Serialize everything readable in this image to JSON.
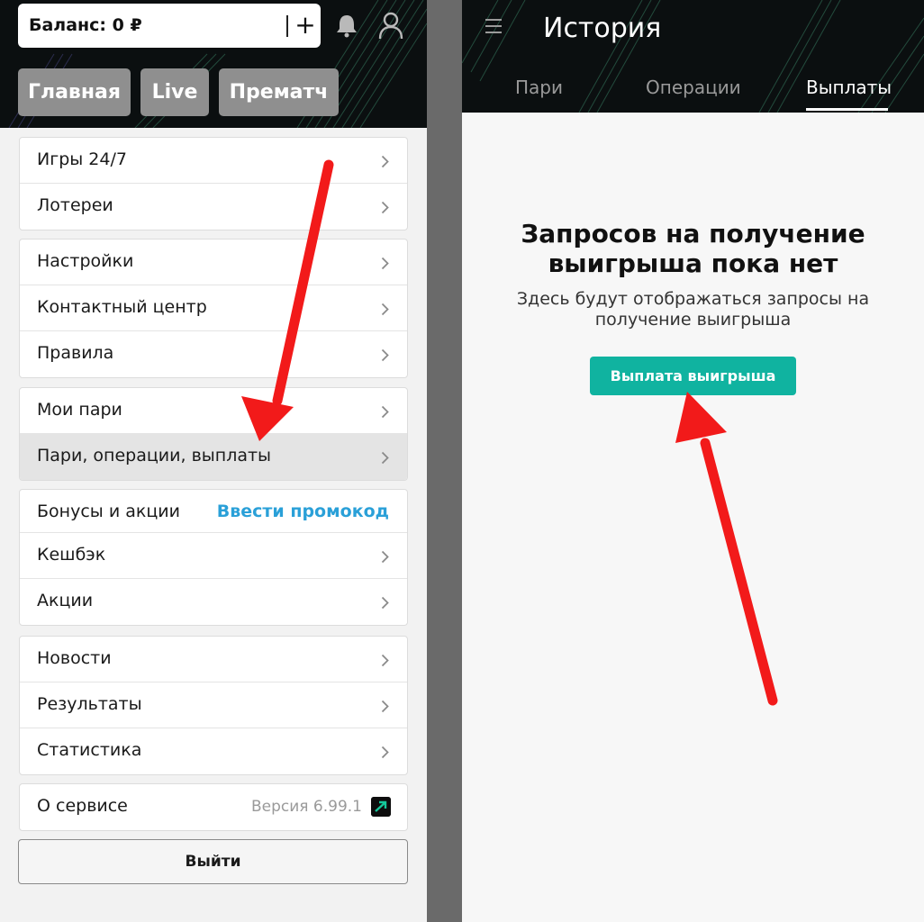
{
  "left": {
    "balance": "Баланс: 0 ₽",
    "balance_plus": "+",
    "nav": {
      "home": "Главная",
      "live": "Live",
      "prematch": "Прематч"
    },
    "groups": [
      {
        "items": [
          {
            "label": "Игры 24/7"
          },
          {
            "label": "Лотереи"
          }
        ]
      },
      {
        "items": [
          {
            "label": "Настройки"
          },
          {
            "label": "Контактный центр"
          },
          {
            "label": "Правила"
          }
        ]
      },
      {
        "items": [
          {
            "label": "Мои пари"
          },
          {
            "label": "Пари, операции, выплаты",
            "active": true
          }
        ]
      },
      {
        "items": [
          {
            "label": "Бонусы и акции",
            "action": "Ввести промокод"
          },
          {
            "label": "Кешбэк"
          },
          {
            "label": "Акции"
          }
        ]
      },
      {
        "items": [
          {
            "label": "Новости"
          },
          {
            "label": "Результаты"
          },
          {
            "label": "Статистика"
          }
        ]
      },
      {
        "items": [
          {
            "label": "О сервисе",
            "version": "Версия 6.99.1"
          }
        ]
      }
    ],
    "logout": "Выйти"
  },
  "right": {
    "title": "История",
    "tabs": [
      "Пари",
      "Операции",
      "Выплаты"
    ],
    "active_tab": "Выплаты",
    "empty_title_line1": "Запросов на получение",
    "empty_title_line2": "выигрыша пока нет",
    "empty_desc_line1": "Здесь будут отображаться запросы на",
    "empty_desc_line2": "получение выигрыша",
    "payout_button": "Выплата выигрыша"
  },
  "colors": {
    "accent": "#10b3a0",
    "promo_link": "#2aa0d8",
    "header_bg": "#0b0f10",
    "nav_button_bg": "#8f8f8f",
    "arrow": "#f21a1a"
  }
}
